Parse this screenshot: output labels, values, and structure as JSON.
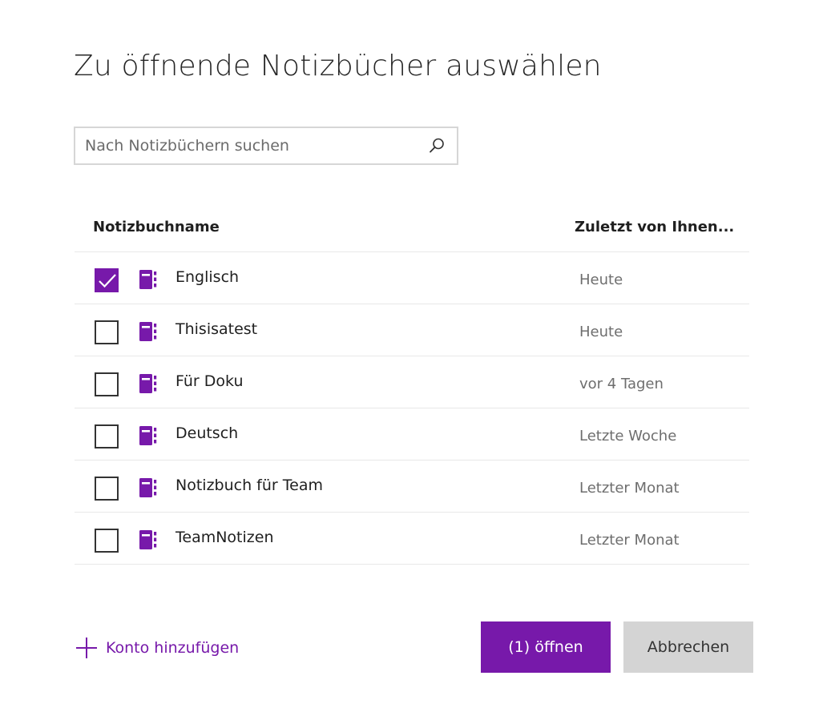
{
  "dialog": {
    "title": "Zu öffnende Notizbücher auswählen"
  },
  "search": {
    "placeholder": "Nach Notizbüchern suchen",
    "value": ""
  },
  "columns": {
    "name": "Notizbuchname",
    "last_opened": "Zuletzt von Ihnen..."
  },
  "notebooks": [
    {
      "name": "Englisch",
      "date": "Heute",
      "checked": true
    },
    {
      "name": "Thisisatest",
      "date": "Heute",
      "checked": false
    },
    {
      "name": "Für Doku",
      "date": "vor 4 Tagen",
      "checked": false
    },
    {
      "name": "Deutsch",
      "date": "Letzte Woche",
      "checked": false
    },
    {
      "name": "Notizbuch für Team",
      "date": "Letzter Monat",
      "checked": false
    },
    {
      "name": "TeamNotizen",
      "date": "Letzter Monat",
      "checked": false
    }
  ],
  "footer": {
    "add_account_label": "Konto hinzufügen",
    "open_label": "(1) öffnen",
    "cancel_label": "Abbrechen"
  },
  "icons": {
    "search": "search-icon",
    "notebook": "notebook-icon",
    "checkmark": "checkmark-icon",
    "plus": "plus-icon"
  },
  "colors": {
    "accent": "#7719aa",
    "cancel_bg": "#d4d4d4",
    "secondary_text": "#6e6e6e"
  }
}
